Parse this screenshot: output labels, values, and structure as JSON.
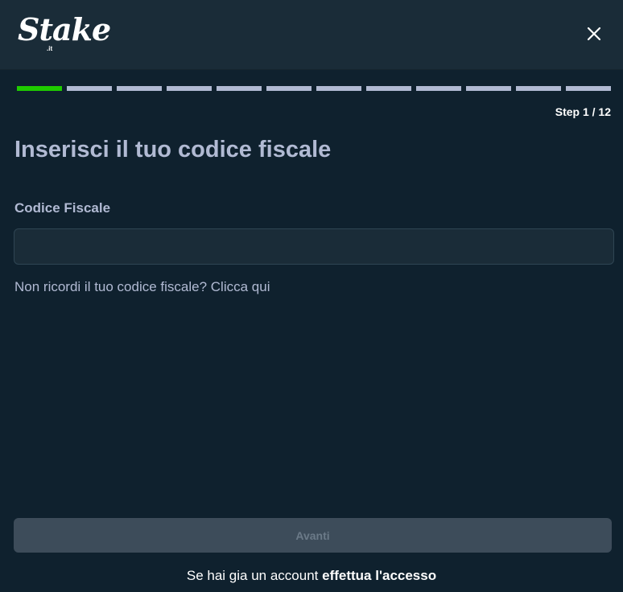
{
  "brand": {
    "logo_text": "Stake",
    "logo_sub": ".it"
  },
  "progress": {
    "current_step": 1,
    "total_steps": 12,
    "step_label": "Step 1 / 12"
  },
  "form": {
    "title": "Inserisci il tuo codice fiscale",
    "field_label": "Codice Fiscale",
    "field_value": "",
    "hint": "Non ricordi il tuo codice fiscale? Clicca qui"
  },
  "actions": {
    "next_label": "Avanti"
  },
  "footer": {
    "prefix": "Se hai gia un account",
    "link": "effettua l'accesso"
  },
  "colors": {
    "header_bg": "#1a2c38",
    "body_bg": "#0f212e",
    "progress_active": "#1fcb00",
    "progress_inactive": "#b1bad3",
    "button_disabled": "#3d4c5a"
  },
  "icons": {
    "close": "close-icon"
  }
}
